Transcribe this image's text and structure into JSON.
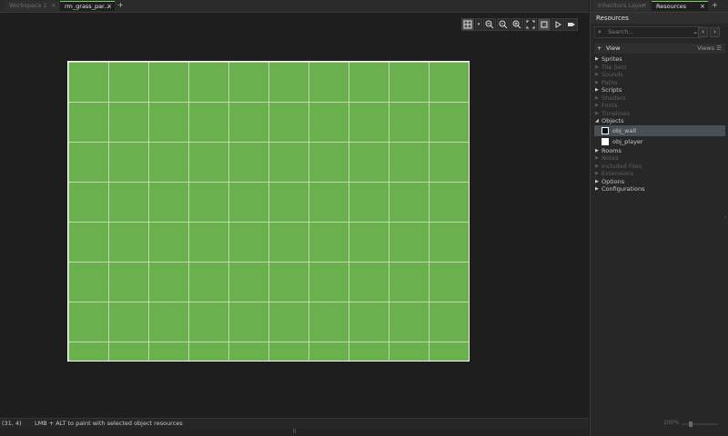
{
  "tabs": [
    {
      "label": "Workspace 1",
      "state": "inactive"
    },
    {
      "label": "rm_grass_par...",
      "state": "active"
    }
  ],
  "add_tab": "+",
  "right_tabs": [
    {
      "label": "Inheritors Layer",
      "state": "inactive"
    },
    {
      "label": "Resources",
      "state": "active"
    }
  ],
  "toolbar": {
    "items": [
      "grid-icon",
      "zoom-out-icon",
      "zoom-reset-icon",
      "zoom-in-icon",
      "fullscreen-icon",
      "frame-icon",
      "play-icon",
      "tag-icon"
    ]
  },
  "room": {
    "fill": "#6ab04c",
    "grid_color": "#ffffff"
  },
  "status": {
    "coords": "(31, 4)",
    "hint": "LMB + ALT to paint with selected object resources"
  },
  "bottom_grip": "⠿",
  "resources": {
    "header": "Resources",
    "search_placeholder": "Search...",
    "view_label": "View",
    "views_label": "Views",
    "zoom": "100%",
    "tree": [
      {
        "label": "Sprites",
        "dim": false,
        "type": "folder",
        "expanded": false
      },
      {
        "label": "Tile Sets",
        "dim": true,
        "type": "folder",
        "expanded": false
      },
      {
        "label": "Sounds",
        "dim": true,
        "type": "folder",
        "expanded": false
      },
      {
        "label": "Paths",
        "dim": true,
        "type": "folder",
        "expanded": false
      },
      {
        "label": "Scripts",
        "dim": false,
        "type": "folder",
        "expanded": false
      },
      {
        "label": "Shaders",
        "dim": true,
        "type": "folder",
        "expanded": false
      },
      {
        "label": "Fonts",
        "dim": true,
        "type": "folder",
        "expanded": false
      },
      {
        "label": "Timelines",
        "dim": true,
        "type": "folder",
        "expanded": false
      },
      {
        "label": "Objects",
        "dim": false,
        "type": "folder",
        "expanded": true
      },
      {
        "label": "obj_wall",
        "dim": false,
        "type": "item",
        "swatch": "#111111",
        "selected": true
      },
      {
        "label": "obj_player",
        "dim": false,
        "type": "item",
        "swatch": "#ffffff",
        "selected": false
      },
      {
        "label": "Rooms",
        "dim": false,
        "type": "folder",
        "expanded": false
      },
      {
        "label": "Notes",
        "dim": true,
        "type": "folder",
        "expanded": false
      },
      {
        "label": "Included Files",
        "dim": true,
        "type": "folder",
        "expanded": false
      },
      {
        "label": "Extensions",
        "dim": true,
        "type": "folder",
        "expanded": false
      },
      {
        "label": "Options",
        "dim": false,
        "type": "folder",
        "expanded": false
      },
      {
        "label": "Configurations",
        "dim": false,
        "type": "folder",
        "expanded": false
      }
    ]
  },
  "colors": {
    "accent": "#7bd06a",
    "background": "#1e1e1e",
    "panel": "#272727"
  }
}
